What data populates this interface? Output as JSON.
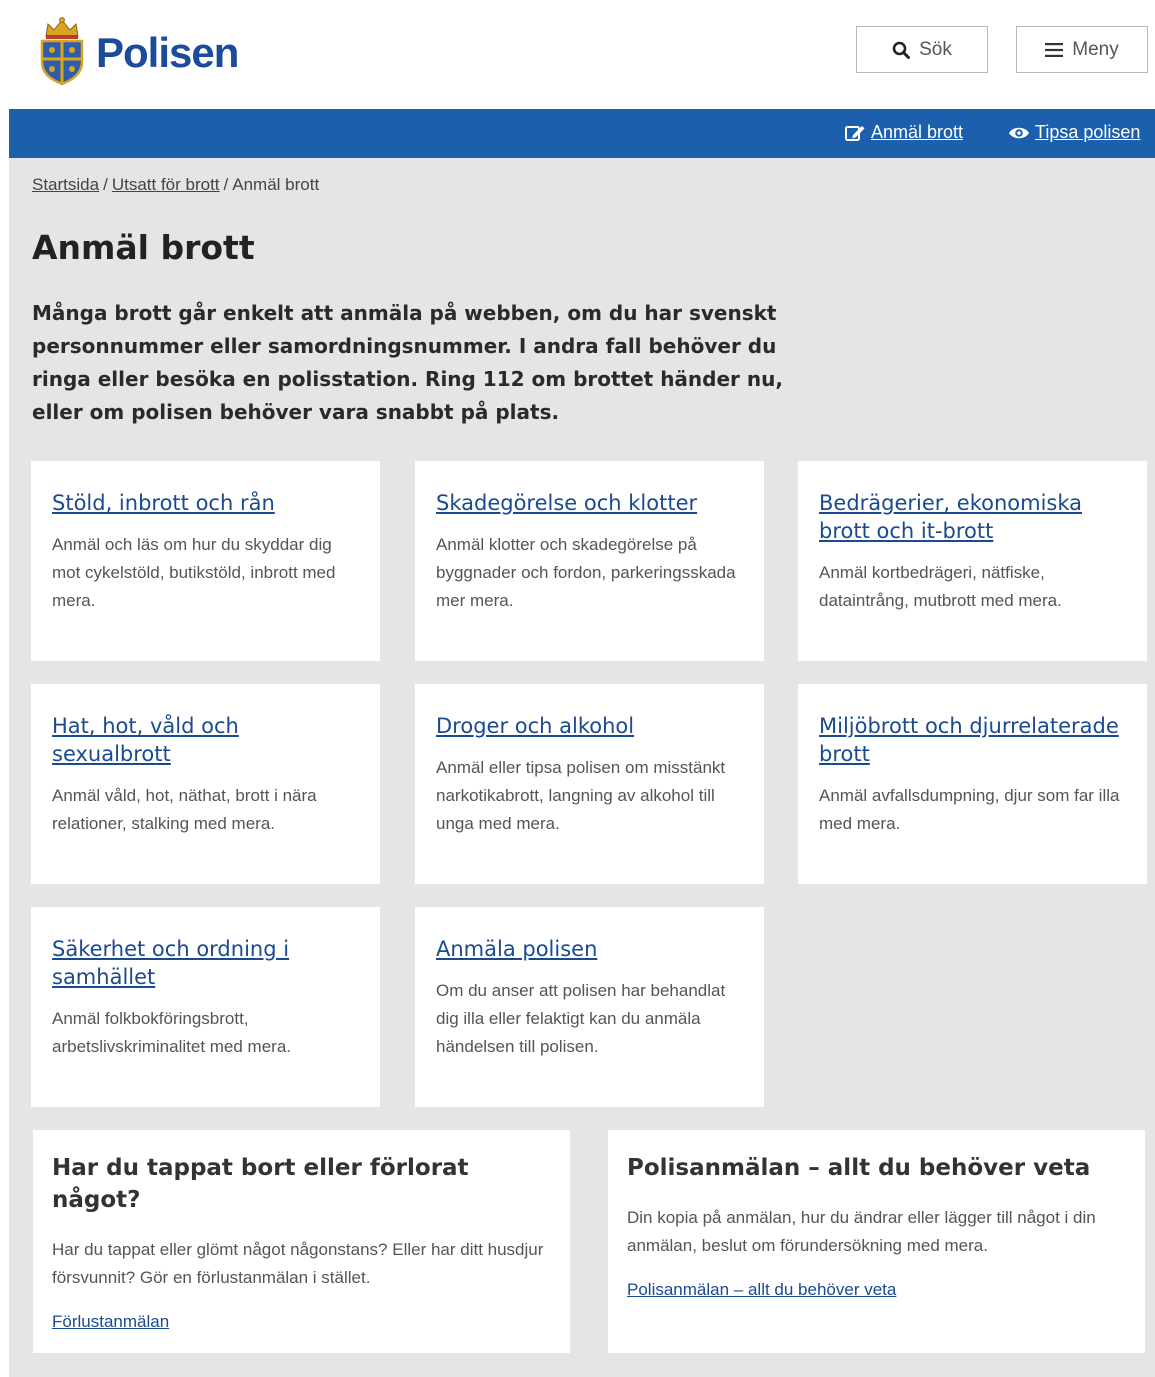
{
  "header": {
    "brand": "Polisen",
    "search_label": "Sök",
    "menu_label": "Meny"
  },
  "topbar": {
    "report_label": "Anmäl brott",
    "tip_label": "Tipsa polisen"
  },
  "breadcrumb": {
    "items": [
      "Startsida",
      "Utsatt för brott"
    ],
    "current": "Anmäl brott"
  },
  "page": {
    "title": "Anmäl brott",
    "intro": "Många brott går enkelt att anmäla på webben, om du har svenskt personnummer eller samordningsnummer. I andra fall behöver du ringa eller besöka en polisstation. Ring 112 om brottet händer nu, eller om polisen behöver vara snabbt på plats."
  },
  "cards": [
    {
      "title": "Stöld, inbrott och rån",
      "desc": "Anmäl och läs om hur du skyddar dig mot cykelstöld, butikstöld, inbrott med mera."
    },
    {
      "title": "Skadegörelse och klotter",
      "desc": "Anmäl klotter och skadegörelse på byggnader och fordon, parkeringsskada mer mera."
    },
    {
      "title": "Bedrägerier, ekonomiska brott och it-brott",
      "desc": "Anmäl kortbedrägeri, nätfiske, dataintrång, mutbrott med mera."
    },
    {
      "title": "Hat, hot, våld och sexualbrott",
      "desc": "Anmäl våld, hot, näthat, brott i nära relationer, stalking med mera."
    },
    {
      "title": "Droger och alkohol",
      "desc": "Anmäl eller tipsa polisen om misstänkt narkotikabrott, langning av alkohol till unga med mera."
    },
    {
      "title": "Miljöbrott och djurrelaterade brott",
      "desc": "Anmäl avfallsdumpning, djur som far illa med mera."
    },
    {
      "title": "Säkerhet och ordning i samhället",
      "desc": "Anmäl folkbokföringsbrott, arbetslivskriminalitet med mera."
    },
    {
      "title": "Anmäla polisen",
      "desc": "Om du anser att polisen har behandlat dig illa eller felaktigt kan du anmäla händelsen till polisen."
    }
  ],
  "info_cards": [
    {
      "title": "Har du tappat bort eller förlorat något?",
      "desc": "Har du tappat eller glömt något någonstans? Eller har ditt husdjur försvunnit? Gör en förlustanmälan i stället.",
      "link": "Förlustanmälan"
    },
    {
      "title": "Polisanmälan – allt du behöver veta",
      "desc": "Din kopia på anmälan, hur du ändrar eller lägger till något i din anmälan, beslut om förundersökning med mera.",
      "link": "Polisanmälan – allt du behöver veta"
    }
  ],
  "colors": {
    "brand_blue": "#1b5fad",
    "link_blue": "#1a4a90",
    "background_gray": "#e5e5e5"
  },
  "icons": {
    "logo": "police-emblem-icon",
    "search": "search-icon",
    "menu": "hamburger-icon",
    "report": "edit-icon",
    "tip": "eye-icon"
  }
}
